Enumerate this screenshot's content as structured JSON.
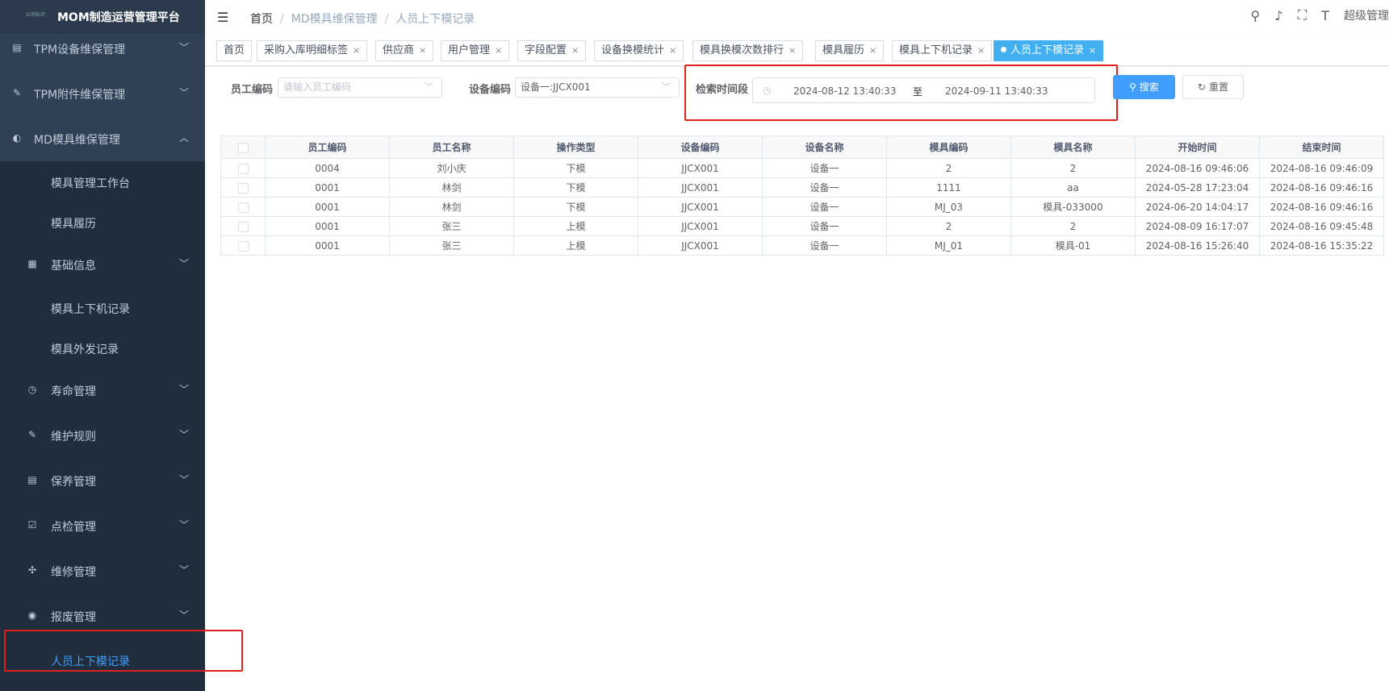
{
  "app": {
    "title": "MOM制造运营管理平台",
    "logo_text": "公司标识"
  },
  "sidebar": {
    "items": [
      {
        "label": "TPM设备维保管理",
        "icon": "server-icon",
        "expanded": false
      },
      {
        "label": "TPM附件维保管理",
        "icon": "edit-icon",
        "expanded": false
      },
      {
        "label": "MD模具维保管理",
        "icon": "palette-icon",
        "expanded": true
      }
    ],
    "sub": {
      "workbench": "模具管理工作台",
      "history": "模具履历",
      "basic": "基础信息",
      "updown": "模具上下机记录",
      "outsource": "模具外发记录",
      "life": "寿命管理",
      "rules": "维护规则",
      "maint": "保养管理",
      "check": "点检管理",
      "repair": "维修管理",
      "scrap": "报废管理",
      "person": "人员上下模记录"
    },
    "active_item": "人员上下模记录",
    "colors": {
      "bg": "#304156",
      "sub_bg": "#1f2d3d",
      "text": "#bfcbd9",
      "active": "#409eff"
    }
  },
  "header": {
    "breadcrumb": [
      "首页",
      "MD模具维保管理",
      "人员上下模记录"
    ],
    "tools": {
      "search": "search-icon",
      "bell": "bell-icon",
      "fullscreen": "fullscreen-icon",
      "font": "font-size-icon"
    },
    "user": "超级管理"
  },
  "tags": [
    {
      "label": "首页",
      "closable": false
    },
    {
      "label": "采购入库明细标签",
      "closable": true
    },
    {
      "label": "供应商",
      "closable": true
    },
    {
      "label": "用户管理",
      "closable": true
    },
    {
      "label": "字段配置",
      "closable": true
    },
    {
      "label": "设备换模统计",
      "closable": true
    },
    {
      "label": "模具换模次数排行",
      "closable": true
    },
    {
      "label": "模具履历",
      "closable": true
    },
    {
      "label": "模具上下机记录",
      "closable": true
    },
    {
      "label": "人员上下模记录",
      "closable": true,
      "active": true
    }
  ],
  "tag_close": "×",
  "filters": {
    "emp_code": {
      "label": "员工编码",
      "placeholder": "请输入员工编码"
    },
    "device_code": {
      "label": "设备编码",
      "value": "设备一:JJCX001"
    },
    "time_range": {
      "label": "检索时间段",
      "start": "2024-08-12 13:40:33",
      "sep": "至",
      "end": "2024-09-11 13:40:33"
    },
    "search_button": "搜索",
    "reset_button": "重置"
  },
  "table": {
    "columns": [
      "员工编码",
      "员工名称",
      "操作类型",
      "设备编码",
      "设备名称",
      "模具编码",
      "模具名称",
      "开始时间",
      "结束时间"
    ],
    "rows": [
      [
        "0004",
        "刘小庆",
        "下模",
        "JJCX001",
        "设备一",
        "2",
        "2",
        "2024-08-16 09:46:06",
        "2024-08-16 09:46:09"
      ],
      [
        "0001",
        "林剑",
        "下模",
        "JJCX001",
        "设备一",
        "1111",
        "aa",
        "2024-05-28 17:23:04",
        "2024-08-16 09:46:16"
      ],
      [
        "0001",
        "林剑",
        "下模",
        "JJCX001",
        "设备一",
        "MJ_03",
        "模具-033000",
        "2024-06-20 14:04:17",
        "2024-08-16 09:46:16"
      ],
      [
        "0001",
        "张三",
        "上模",
        "JJCX001",
        "设备一",
        "2",
        "2",
        "2024-08-09 16:17:07",
        "2024-08-16 09:45:48"
      ],
      [
        "0001",
        "张三",
        "上模",
        "JJCX001",
        "设备一",
        "MJ_01",
        "模具-01",
        "2024-08-16 15:26:40",
        "2024-08-16 15:35:22"
      ]
    ]
  },
  "highlight_color": "#e02020"
}
